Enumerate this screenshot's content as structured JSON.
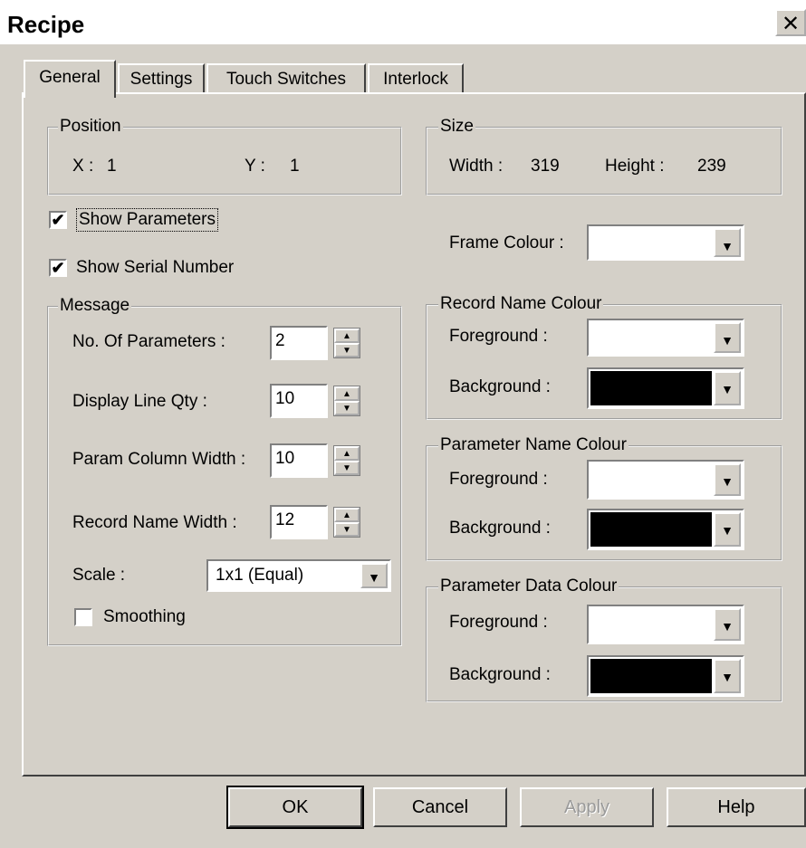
{
  "window": {
    "title": "Recipe",
    "close_glyph": "✕"
  },
  "tabs": [
    "General",
    "Settings",
    "Touch Switches",
    "Interlock"
  ],
  "position": {
    "legend": "Position",
    "x_label": "X :",
    "x_value": "1",
    "y_label": "Y :",
    "y_value": "1"
  },
  "size": {
    "legend": "Size",
    "width_label": "Width :",
    "width_value": "319",
    "height_label": "Height :",
    "height_value": "239"
  },
  "show_parameters": {
    "label": "Show Parameters",
    "checked": true
  },
  "show_serial": {
    "label": "Show Serial Number",
    "checked": true
  },
  "frame_colour": {
    "label": "Frame Colour :",
    "value": "#ffffff"
  },
  "message": {
    "legend": "Message",
    "no_params": {
      "label": "No. Of Parameters :",
      "value": "2"
    },
    "display_lines": {
      "label": "Display Line Qty :",
      "value": "10"
    },
    "param_col_width": {
      "label": "Param Column Width :",
      "value": "10"
    },
    "record_name_width": {
      "label": "Record Name Width :",
      "value": "12"
    },
    "scale": {
      "label": "Scale :",
      "value": "1x1 (Equal)"
    },
    "smoothing": {
      "label": "Smoothing",
      "checked": false
    }
  },
  "record_name_colour": {
    "legend": "Record Name Colour",
    "fg_label": "Foreground :",
    "fg": "#ffffff",
    "bg_label": "Background :",
    "bg": "#000000"
  },
  "parameter_name_colour": {
    "legend": "Parameter Name Colour",
    "fg_label": "Foreground :",
    "fg": "#ffffff",
    "bg_label": "Background :",
    "bg": "#000000"
  },
  "parameter_data_colour": {
    "legend": "Parameter Data Colour",
    "fg_label": "Foreground :",
    "fg": "#ffffff",
    "bg_label": "Background :",
    "bg": "#000000"
  },
  "buttons": {
    "ok": "OK",
    "cancel": "Cancel",
    "apply": "Apply",
    "help": "Help"
  },
  "icons": {
    "check": "✔",
    "spin_up": "▲",
    "spin_down": "▼",
    "dropdown": "▼"
  }
}
